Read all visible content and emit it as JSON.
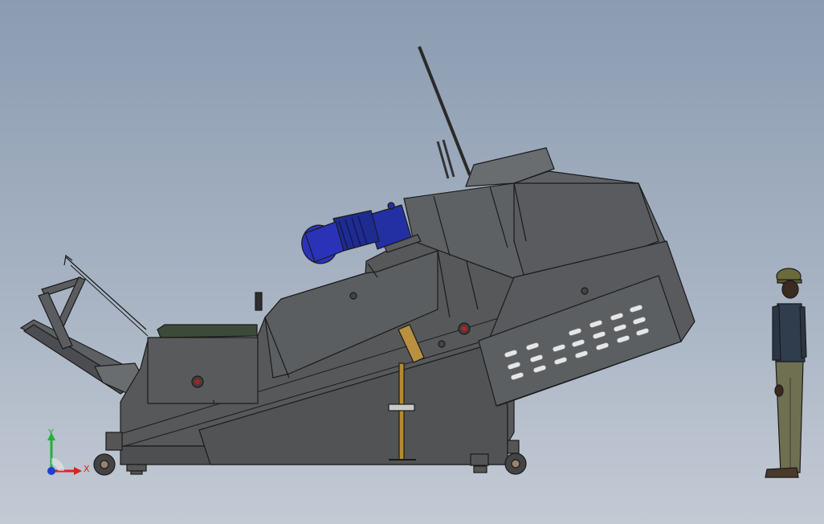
{
  "axes": {
    "x_label": "X",
    "y_label": "Y",
    "x_color": "#e02020",
    "y_color": "#1fb23a",
    "z_color": "#1f3fd0"
  },
  "colors": {
    "machine_body": "#555759",
    "machine_light": "#65686b",
    "machine_dark": "#3d3f41",
    "edge": "#1b1b1b",
    "motor": "#2a33b8",
    "support_post": "#b58b2e",
    "worker_shirt": "#2f3d4d",
    "worker_pants": "#6f6f52",
    "worker_helmet": "#6b6a3a"
  },
  "objects": {
    "machine": "conveyor-machine",
    "motor": "electric-motor",
    "figure": "worker-figure"
  }
}
